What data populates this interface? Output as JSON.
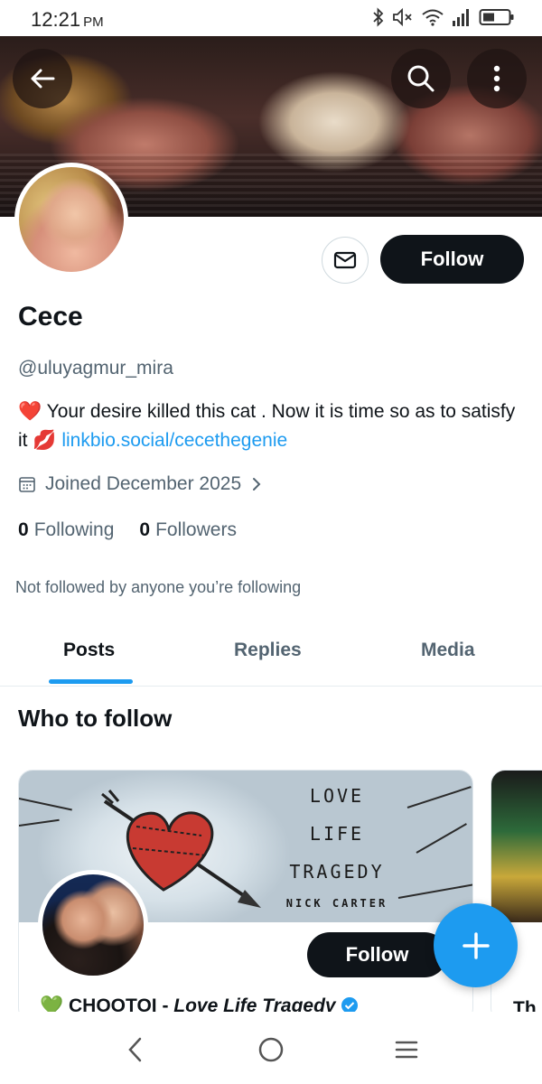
{
  "status_bar": {
    "time": "12:21",
    "ampm": "PM",
    "icons": [
      "bluetooth-icon",
      "mute-icon",
      "wifi-icon",
      "signal-icon",
      "battery-icon"
    ]
  },
  "header": {
    "back_icon": "arrow-left-icon",
    "search_icon": "search-icon",
    "more_icon": "more-vertical-icon"
  },
  "profile": {
    "message_icon": "envelope-icon",
    "follow_label": "Follow",
    "name": "Cece",
    "handle": "@uluyagmur_mira",
    "bio_heart": "❤️",
    "bio_text": "Your desire killed this cat . Now it is time so as to satisfy it",
    "bio_lips": "💋",
    "bio_link": "linkbio.social/cecethegenie",
    "joined": "Joined December 2025",
    "following_count": "0",
    "following_label": "Following",
    "followers_count": "0",
    "followers_label": "Followers",
    "not_followed": "Not followed by anyone you’re following"
  },
  "tabs": [
    {
      "label": "Posts",
      "active": true
    },
    {
      "label": "Replies",
      "active": false
    },
    {
      "label": "Media",
      "active": false
    }
  ],
  "who_to_follow": {
    "title": "Who to follow",
    "cards": [
      {
        "banner_lines": [
          "LOVE",
          "LIFE",
          "TRAGEDY",
          "NICK CARTER"
        ],
        "follow_label": "Follow",
        "name_prefix": "CHOOTOI - ",
        "name_italic": "Love Life Tragedy",
        "heart": "💚",
        "verified": true
      },
      {
        "name_partial": "Th"
      }
    ]
  },
  "fab_icon": "plus-icon",
  "nav_bar": [
    "back-nav-icon",
    "home-nav-icon",
    "recents-nav-icon"
  ],
  "colors": {
    "accent": "#1d9bf0",
    "primary_text": "#0f1419",
    "secondary_text": "#536471"
  }
}
